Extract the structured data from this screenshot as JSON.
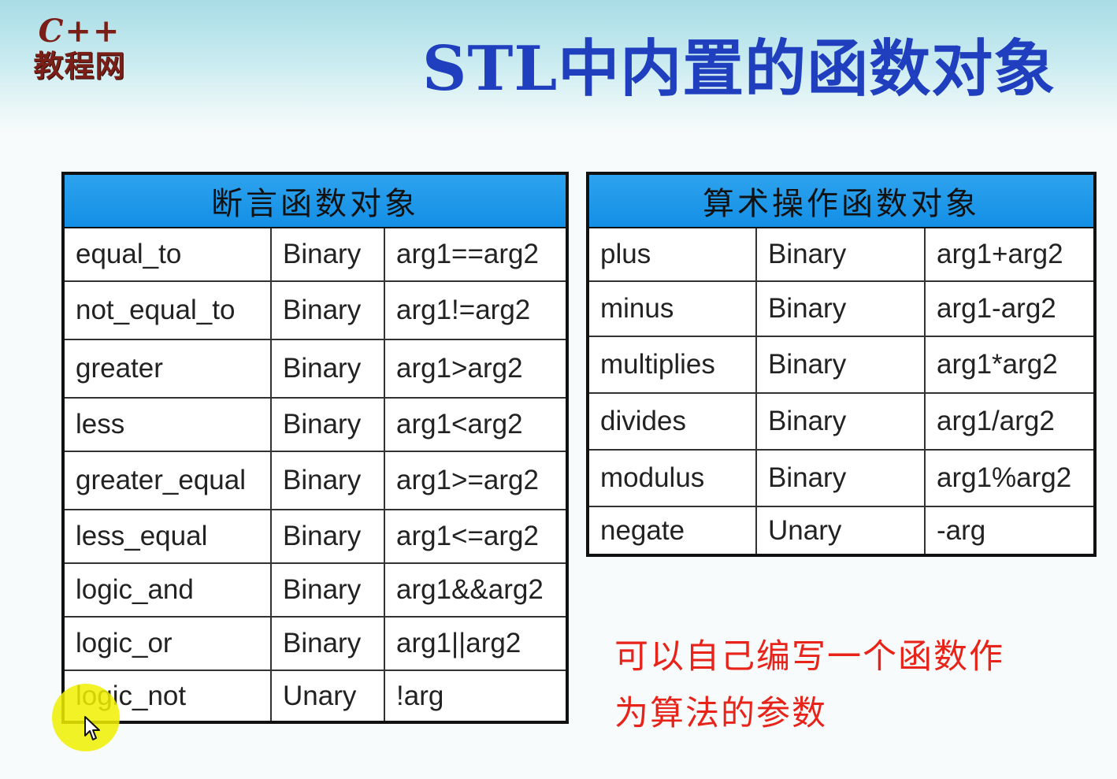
{
  "header": {
    "logo_line1": "C++",
    "logo_line2": "教程网",
    "title": "STL中内置的函数对象"
  },
  "predicate_table": {
    "title": "断言函数对象",
    "rows": [
      [
        "equal_to",
        "Binary",
        "arg1==arg2"
      ],
      [
        "not_equal_to",
        "Binary",
        "arg1!=arg2"
      ],
      [
        "greater",
        "Binary",
        "arg1>arg2"
      ],
      [
        "less",
        "Binary",
        "arg1<arg2"
      ],
      [
        "greater_equal",
        "Binary",
        "arg1>=arg2"
      ],
      [
        "less_equal",
        "Binary",
        "arg1<=arg2"
      ],
      [
        "logic_and",
        "Binary",
        "arg1&&arg2"
      ],
      [
        "logic_or",
        "Binary",
        "arg1||arg2"
      ],
      [
        "logic_not",
        "Unary",
        "!arg"
      ]
    ]
  },
  "arithmetic_table": {
    "title": "算术操作函数对象",
    "rows": [
      [
        "plus",
        "Binary",
        "arg1+arg2"
      ],
      [
        "minus",
        "Binary",
        "arg1-arg2"
      ],
      [
        "multiplies",
        "Binary",
        "arg1*arg2"
      ],
      [
        "divides",
        "Binary",
        "arg1/arg2"
      ],
      [
        "modulus",
        "Binary",
        "arg1%arg2"
      ],
      [
        "negate",
        "Unary",
        "-arg"
      ]
    ]
  },
  "note": {
    "line1": "可以自己编写一个函数作",
    "line2": "为算法的参数"
  },
  "colors": {
    "title": "#1f3fbf",
    "table_header": "#1a93e8",
    "note": "#e8231a",
    "logo": "#7a1f17"
  },
  "cursor": {
    "icon": "mouse-pointer-icon",
    "highlight": "yellow"
  }
}
